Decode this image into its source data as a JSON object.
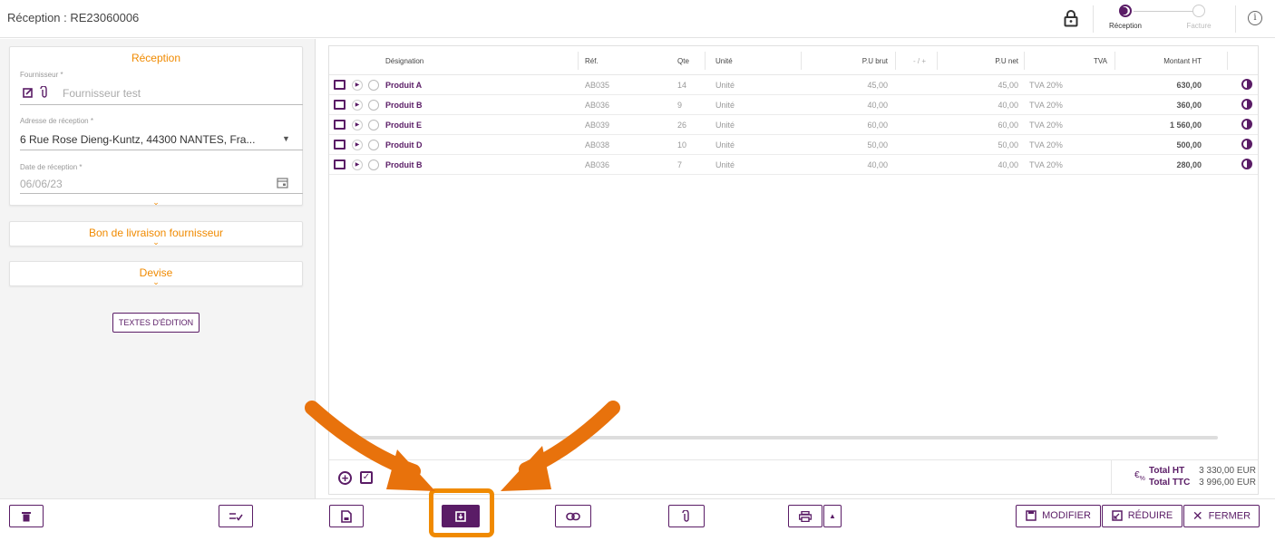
{
  "header": {
    "title": "Réception : RE23060006",
    "steps": [
      {
        "label": "Réception"
      },
      {
        "label": "Facture"
      }
    ],
    "icons": [
      "lock-icon",
      "info-icon"
    ]
  },
  "left": {
    "reception_card": {
      "title": "Réception",
      "supplier_label": "Fournisseur *",
      "supplier_value": "Fournisseur test",
      "address_label": "Adresse de réception *",
      "address_value": "6 Rue Rose Dieng-Kuntz, 44300 NANTES, Fra...",
      "date_label": "Date de réception *",
      "date_value": "06/06/23"
    },
    "delivery_card_title": "Bon de livraison fournisseur",
    "currency_card_title": "Devise",
    "edit_texts_button": "TEXTES D'ÉDITION"
  },
  "table": {
    "headers": {
      "designation": "Désignation",
      "ref": "Réf.",
      "qty": "Qte",
      "unit": "Unité",
      "pu_brut": "P.U brut",
      "minus_plus": "- / +",
      "pu_net": "P.U net",
      "tva": "TVA",
      "montant": "Montant HT"
    },
    "rows": [
      {
        "name": "Produit A",
        "ref": "AB035",
        "qty": "14",
        "unit": "Unité",
        "pu_brut": "45,00",
        "pu_net": "45,00",
        "tva": "TVA 20%",
        "montant": "630,00"
      },
      {
        "name": "Produit B",
        "ref": "AB036",
        "qty": "9",
        "unit": "Unité",
        "pu_brut": "40,00",
        "pu_net": "40,00",
        "tva": "TVA 20%",
        "montant": "360,00"
      },
      {
        "name": "Produit E",
        "ref": "AB039",
        "qty": "26",
        "unit": "Unité",
        "pu_brut": "60,00",
        "pu_net": "60,00",
        "tva": "TVA 20%",
        "montant": "1 560,00"
      },
      {
        "name": "Produit D",
        "ref": "AB038",
        "qty": "10",
        "unit": "Unité",
        "pu_brut": "50,00",
        "pu_net": "50,00",
        "tva": "TVA 20%",
        "montant": "500,00"
      },
      {
        "name": "Produit B",
        "ref": "AB036",
        "qty": "7",
        "unit": "Unité",
        "pu_brut": "40,00",
        "pu_net": "40,00",
        "tva": "TVA 20%",
        "montant": "280,00"
      }
    ],
    "totals": {
      "ht_label": "Total HT",
      "ht_value": "3 330,00 EUR",
      "ttc_label": "Total TTC",
      "ttc_value": "3 996,00 EUR"
    }
  },
  "toolbar": {
    "modify_label": "MODIFIER",
    "reduce_label": "RÉDUIRE",
    "close_label": "FERMER"
  },
  "colors": {
    "accent": "#5a1c66",
    "orange": "#f08a00",
    "annotation": "#e8720c"
  }
}
